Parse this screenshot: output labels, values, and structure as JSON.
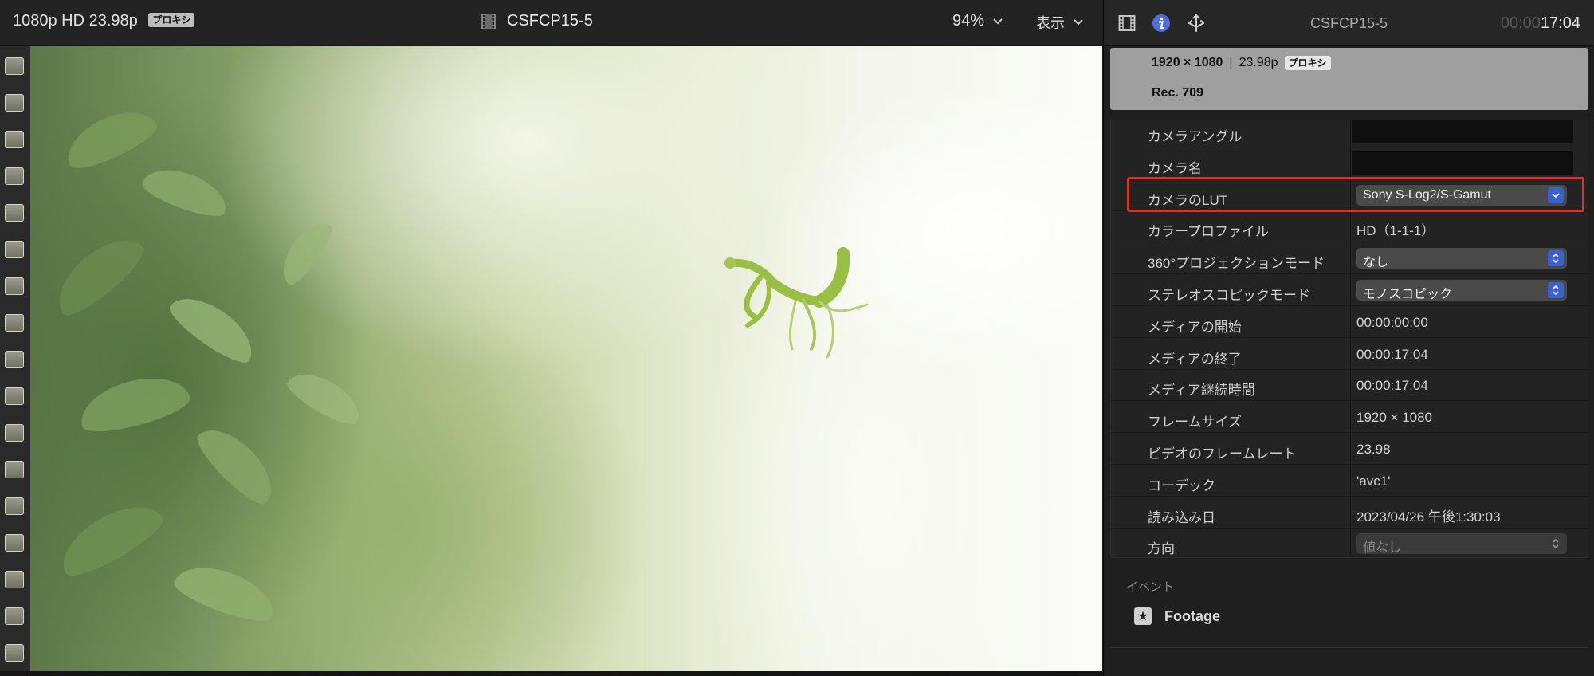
{
  "viewer": {
    "format": "1080p HD 23.98p",
    "proxy_badge": "プロキシ",
    "clip_title": "CSFCP15-5",
    "zoom": "94%",
    "view_menu": "表示"
  },
  "inspector": {
    "clip_title": "CSFCP15-5",
    "timecode_dim": "00:00",
    "timecode": "17:04",
    "tab_icons": [
      "film-icon",
      "info-icon",
      "share-icon"
    ],
    "summary": {
      "resolution": "1920 × 1080",
      "frame_rate": "23.98p",
      "proxy_badge": "プロキシ",
      "color_space": "Rec. 709"
    },
    "rows": [
      {
        "label": "カメラアングル",
        "type": "field",
        "value": ""
      },
      {
        "label": "カメラ名",
        "type": "field",
        "value": ""
      },
      {
        "label": "カメラのLUT",
        "type": "popup",
        "value": "Sony S-Log2/S-Gamut"
      },
      {
        "label": "カラープロファイル",
        "type": "text",
        "value": "HD（1-1-1）"
      },
      {
        "label": "360°プロジェクションモード",
        "type": "popup",
        "value": "なし"
      },
      {
        "label": "ステレオスコピックモード",
        "type": "popup",
        "value": "モノスコピック"
      },
      {
        "label": "メディアの開始",
        "type": "text",
        "value": "00:00:00:00"
      },
      {
        "label": "メディアの終了",
        "type": "text",
        "value": "00:00:17:04"
      },
      {
        "label": "メディア継続時間",
        "type": "text",
        "value": "00:00:17:04"
      },
      {
        "label": "フレームサイズ",
        "type": "text",
        "value": "1920 × 1080"
      },
      {
        "label": "ビデオのフレームレート",
        "type": "text",
        "value": "23.98"
      },
      {
        "label": "コーデック",
        "type": "text",
        "value": "'avc1'"
      },
      {
        "label": "読み込み日",
        "type": "text",
        "value": "2023/04/26 午後1:30:03"
      },
      {
        "label": "方向",
        "type": "popup-dim",
        "value": "値なし"
      }
    ],
    "event_section": {
      "label": "イベント",
      "event_name": "Footage"
    },
    "colors": {
      "highlight": "#d9342b",
      "accent": "#3b5fd3"
    }
  }
}
